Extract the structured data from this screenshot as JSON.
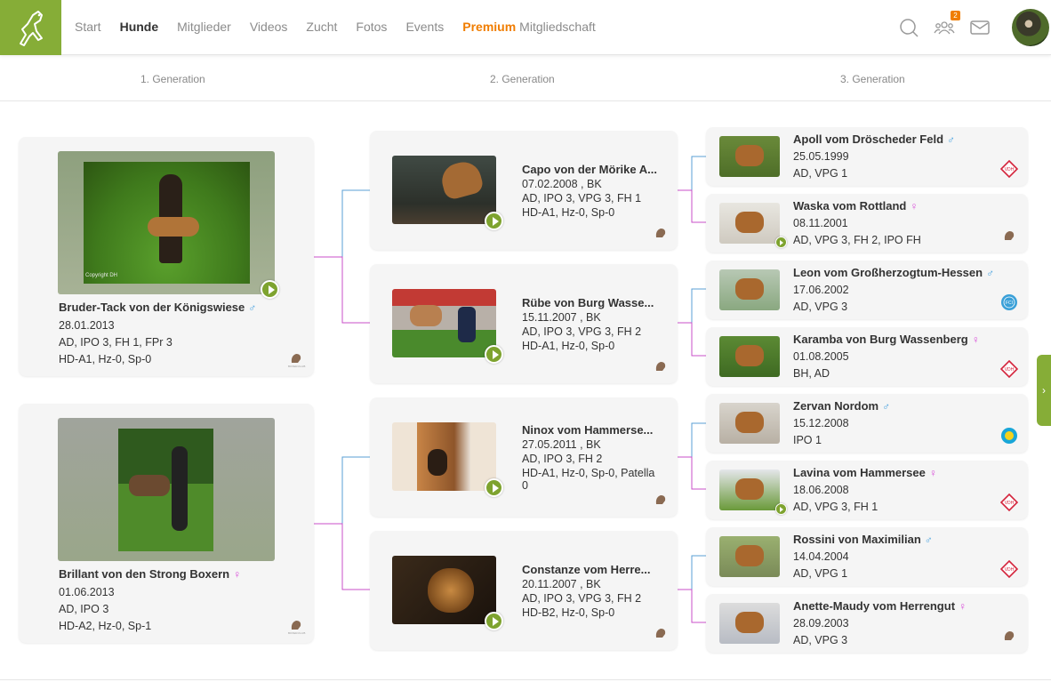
{
  "nav": {
    "items": [
      "Start",
      "Hunde",
      "Mitglieder",
      "Videos",
      "Zucht",
      "Fotos",
      "Events"
    ],
    "active_index": 1,
    "premium_highlight": "Premium",
    "premium_rest": "Mitgliedschaft",
    "notification_count": "2"
  },
  "generations": [
    "1. Generation",
    "2. Generation",
    "3. Generation"
  ],
  "gen1": [
    {
      "name": "Bruder-Tack von der Königswiese",
      "sex": "♂",
      "dob": "28.01.2013",
      "titles": "AD, IPO 3, FH 1, FPr 3",
      "health": "HD-A1, Hz-0, Sp-0",
      "photo_caption": "Copyright DH"
    },
    {
      "name": "Brillant von den Strong Boxern",
      "sex": "♀",
      "dob": "01.06.2013",
      "titles": "AD, IPO 3",
      "health": "HD-A2, Hz-0, Sp-1"
    }
  ],
  "gen2": [
    {
      "name": "Capo von der Mörike A...",
      "dob": "07.02.2008 , BK",
      "titles": "AD, IPO 3, VPG 3, FH 1",
      "health": "HD-A1, Hz-0, Sp-0"
    },
    {
      "name": "Rübe von Burg Wasse...",
      "dob": "15.11.2007 , BK",
      "titles": "AD, IPO 3, VPG 3, FH 2",
      "health": "HD-A1, Hz-0, Sp-0"
    },
    {
      "name": "Ninox vom Hammerse...",
      "dob": "27.05.2011 , BK",
      "titles": "AD, IPO 3, FH 2",
      "health": "HD-A1, Hz-0, Sp-0, Patella",
      "health2": "0"
    },
    {
      "name": "Constanze vom Herre...",
      "dob": "20.11.2007 , BK",
      "titles": "AD, IPO 3, VPG 3, FH 2",
      "health": "HD-B2, Hz-0, Sp-0"
    }
  ],
  "gen3": [
    {
      "name": "Apoll vom Dröscheder Feld",
      "sex": "♂",
      "dob": "25.05.1999",
      "titles": "AD, VPG 1",
      "club": "vdh"
    },
    {
      "name": "Waska vom Rottland",
      "sex": "♀",
      "dob": "08.11.2001",
      "titles": "AD, VPG 3, FH 2, IPO FH",
      "club": "boxer"
    },
    {
      "name": "Leon vom Großherzogtum-Hessen",
      "sex": "♂",
      "dob": "17.06.2002",
      "titles": "AD, VPG 3",
      "club": "fci"
    },
    {
      "name": "Karamba von Burg Wassenberg",
      "sex": "♀",
      "dob": "01.08.2005",
      "titles": "BH, AD",
      "club": "vdh"
    },
    {
      "name": "Zervan Nordom",
      "sex": "♂",
      "dob": "15.12.2008",
      "titles": "IPO 1",
      "club": "fci2"
    },
    {
      "name": "Lavina vom Hammersee",
      "sex": "♀",
      "dob": "18.06.2008",
      "titles": "AD, VPG 3, FH 1",
      "club": "vdh"
    },
    {
      "name": "Rossini von Maximilian",
      "sex": "♂",
      "dob": "14.04.2004",
      "titles": "AD, VPG 1",
      "club": "vdh"
    },
    {
      "name": "Anette-Maudy vom Herrengut",
      "sex": "♀",
      "dob": "28.09.2003",
      "titles": "AD, VPG 3",
      "club": "boxer"
    }
  ],
  "colors": {
    "accent": "#86ad37",
    "premium": "#f07d00",
    "male": "#4aa3df",
    "female": "#d94fd9",
    "line_male": "#5a9fd4",
    "line_female": "#c94fc9"
  }
}
